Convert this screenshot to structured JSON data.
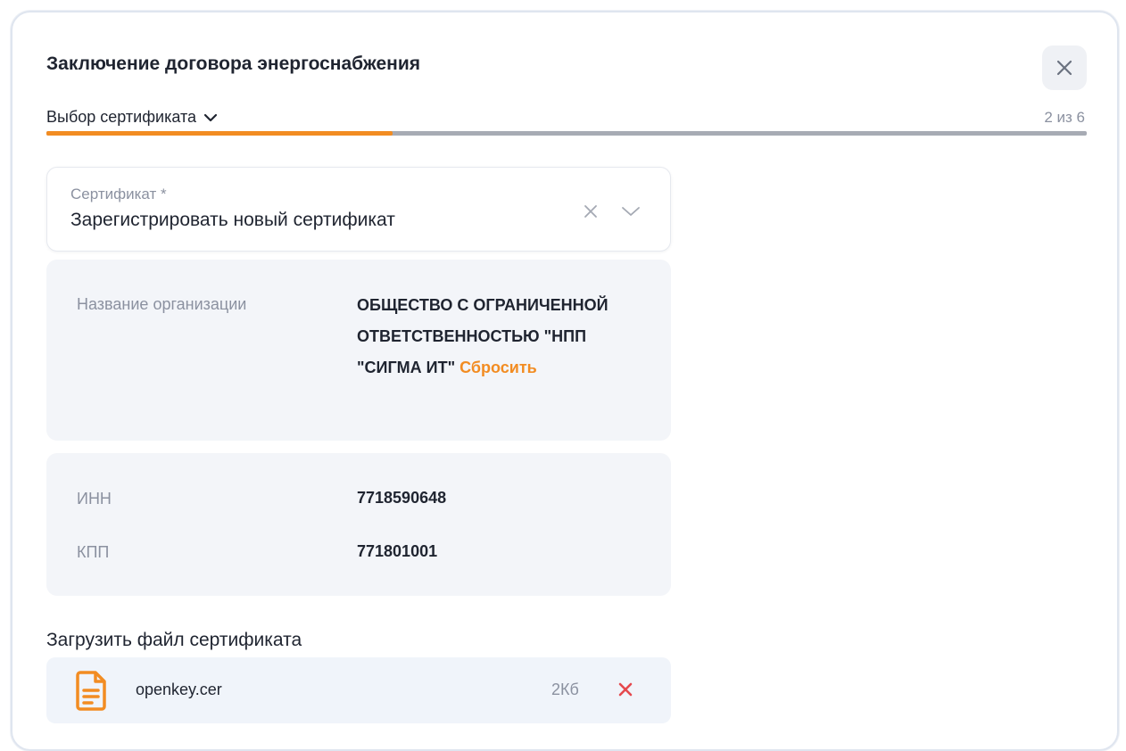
{
  "dialog": {
    "title": "Заключение договора энергоснабжения",
    "close_icon": "close-icon"
  },
  "step": {
    "label": "Выбор сертификата",
    "counter": "2 из 6",
    "current": 2,
    "total": 6,
    "progress_fraction": 0.333,
    "chevron_icon": "chevron-down-icon"
  },
  "certificate_select": {
    "label": "Сертификат *",
    "value": "Зарегистрировать новый сертификат",
    "clear_icon": "clear-icon",
    "dropdown_icon": "chevron-down-icon"
  },
  "organization": {
    "label": "Название организации",
    "value": "ОБЩЕСТВО С ОГРАНИЧЕННОЙ ОТВЕТСТВЕННОСТЬЮ \"НПП \"СИГМА ИТ\"",
    "reset_label": "Сбросить"
  },
  "ids": [
    {
      "label": "ИНН",
      "value": "7718590648"
    },
    {
      "label": "КПП",
      "value": "771801001"
    }
  ],
  "upload": {
    "title": "Загрузить файл сертификата",
    "file": {
      "name": "openkey.cer",
      "size": "2Кб",
      "icon": "document-icon",
      "remove_icon": "remove-icon"
    }
  },
  "colors": {
    "accent": "#f28c22",
    "remove": "#e5484d",
    "muted_text": "#8b91a0",
    "panel_bg": "#f3f5f9"
  }
}
